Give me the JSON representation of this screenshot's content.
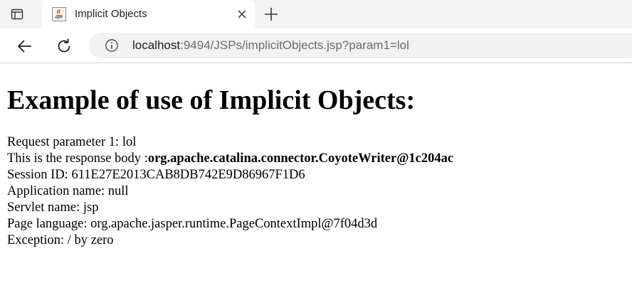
{
  "browser": {
    "tab": {
      "title": "Implicit Objects",
      "favicon": "java-coffee-icon"
    },
    "tab_actions_icon": "tab-actions-icon",
    "new_tab_icon": "plus-icon",
    "close_icon": "close-icon",
    "back_icon": "back-arrow-icon",
    "reload_icon": "reload-icon",
    "site_info_icon": "info-icon",
    "address": {
      "host": "localhost",
      "rest": ":9494/JSPs/implicitObjects.jsp?param1=lol"
    }
  },
  "page": {
    "heading": "Example of use of Implicit Objects:",
    "lines": [
      {
        "label": "Request parameter 1: ",
        "value": "lol",
        "bold": false
      },
      {
        "label": "This is the response body :",
        "value": "org.apache.catalina.connector.CoyoteWriter@1c204ac",
        "bold": true
      },
      {
        "label": "Session ID: ",
        "value": "611E27E2013CAB8DB742E9D86967F1D6",
        "bold": false
      },
      {
        "label": "Application name: ",
        "value": "null",
        "bold": false
      },
      {
        "label": "Servlet name: ",
        "value": "jsp",
        "bold": false
      },
      {
        "label": "Page language: ",
        "value": "org.apache.jasper.runtime.PageContextImpl@7f04d3d",
        "bold": false
      },
      {
        "label": "Exception: ",
        "value": "/ by zero",
        "bold": false
      }
    ]
  }
}
